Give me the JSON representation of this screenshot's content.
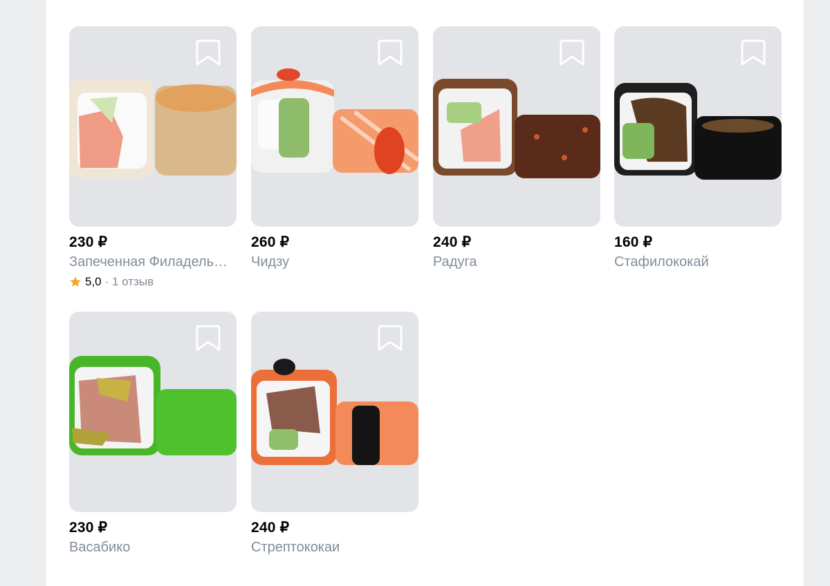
{
  "currency": "₽",
  "products": [
    {
      "price": "230 ₽",
      "name": "Запеченная Филадельфия",
      "rating": "5,0",
      "reviews": "· 1 отзыв"
    },
    {
      "price": "260 ₽",
      "name": "Чидзу"
    },
    {
      "price": "240 ₽",
      "name": "Радуга"
    },
    {
      "price": "160 ₽",
      "name": "Стафилококай"
    },
    {
      "price": "230 ₽",
      "name": "Васабико"
    },
    {
      "price": "240 ₽",
      "name": "Стрептококаи"
    }
  ],
  "colors": {
    "rating_star": "#f5a623",
    "muted_text": "#818c99"
  },
  "icons": {
    "bookmark": "bookmark-icon",
    "star": "star-icon"
  }
}
